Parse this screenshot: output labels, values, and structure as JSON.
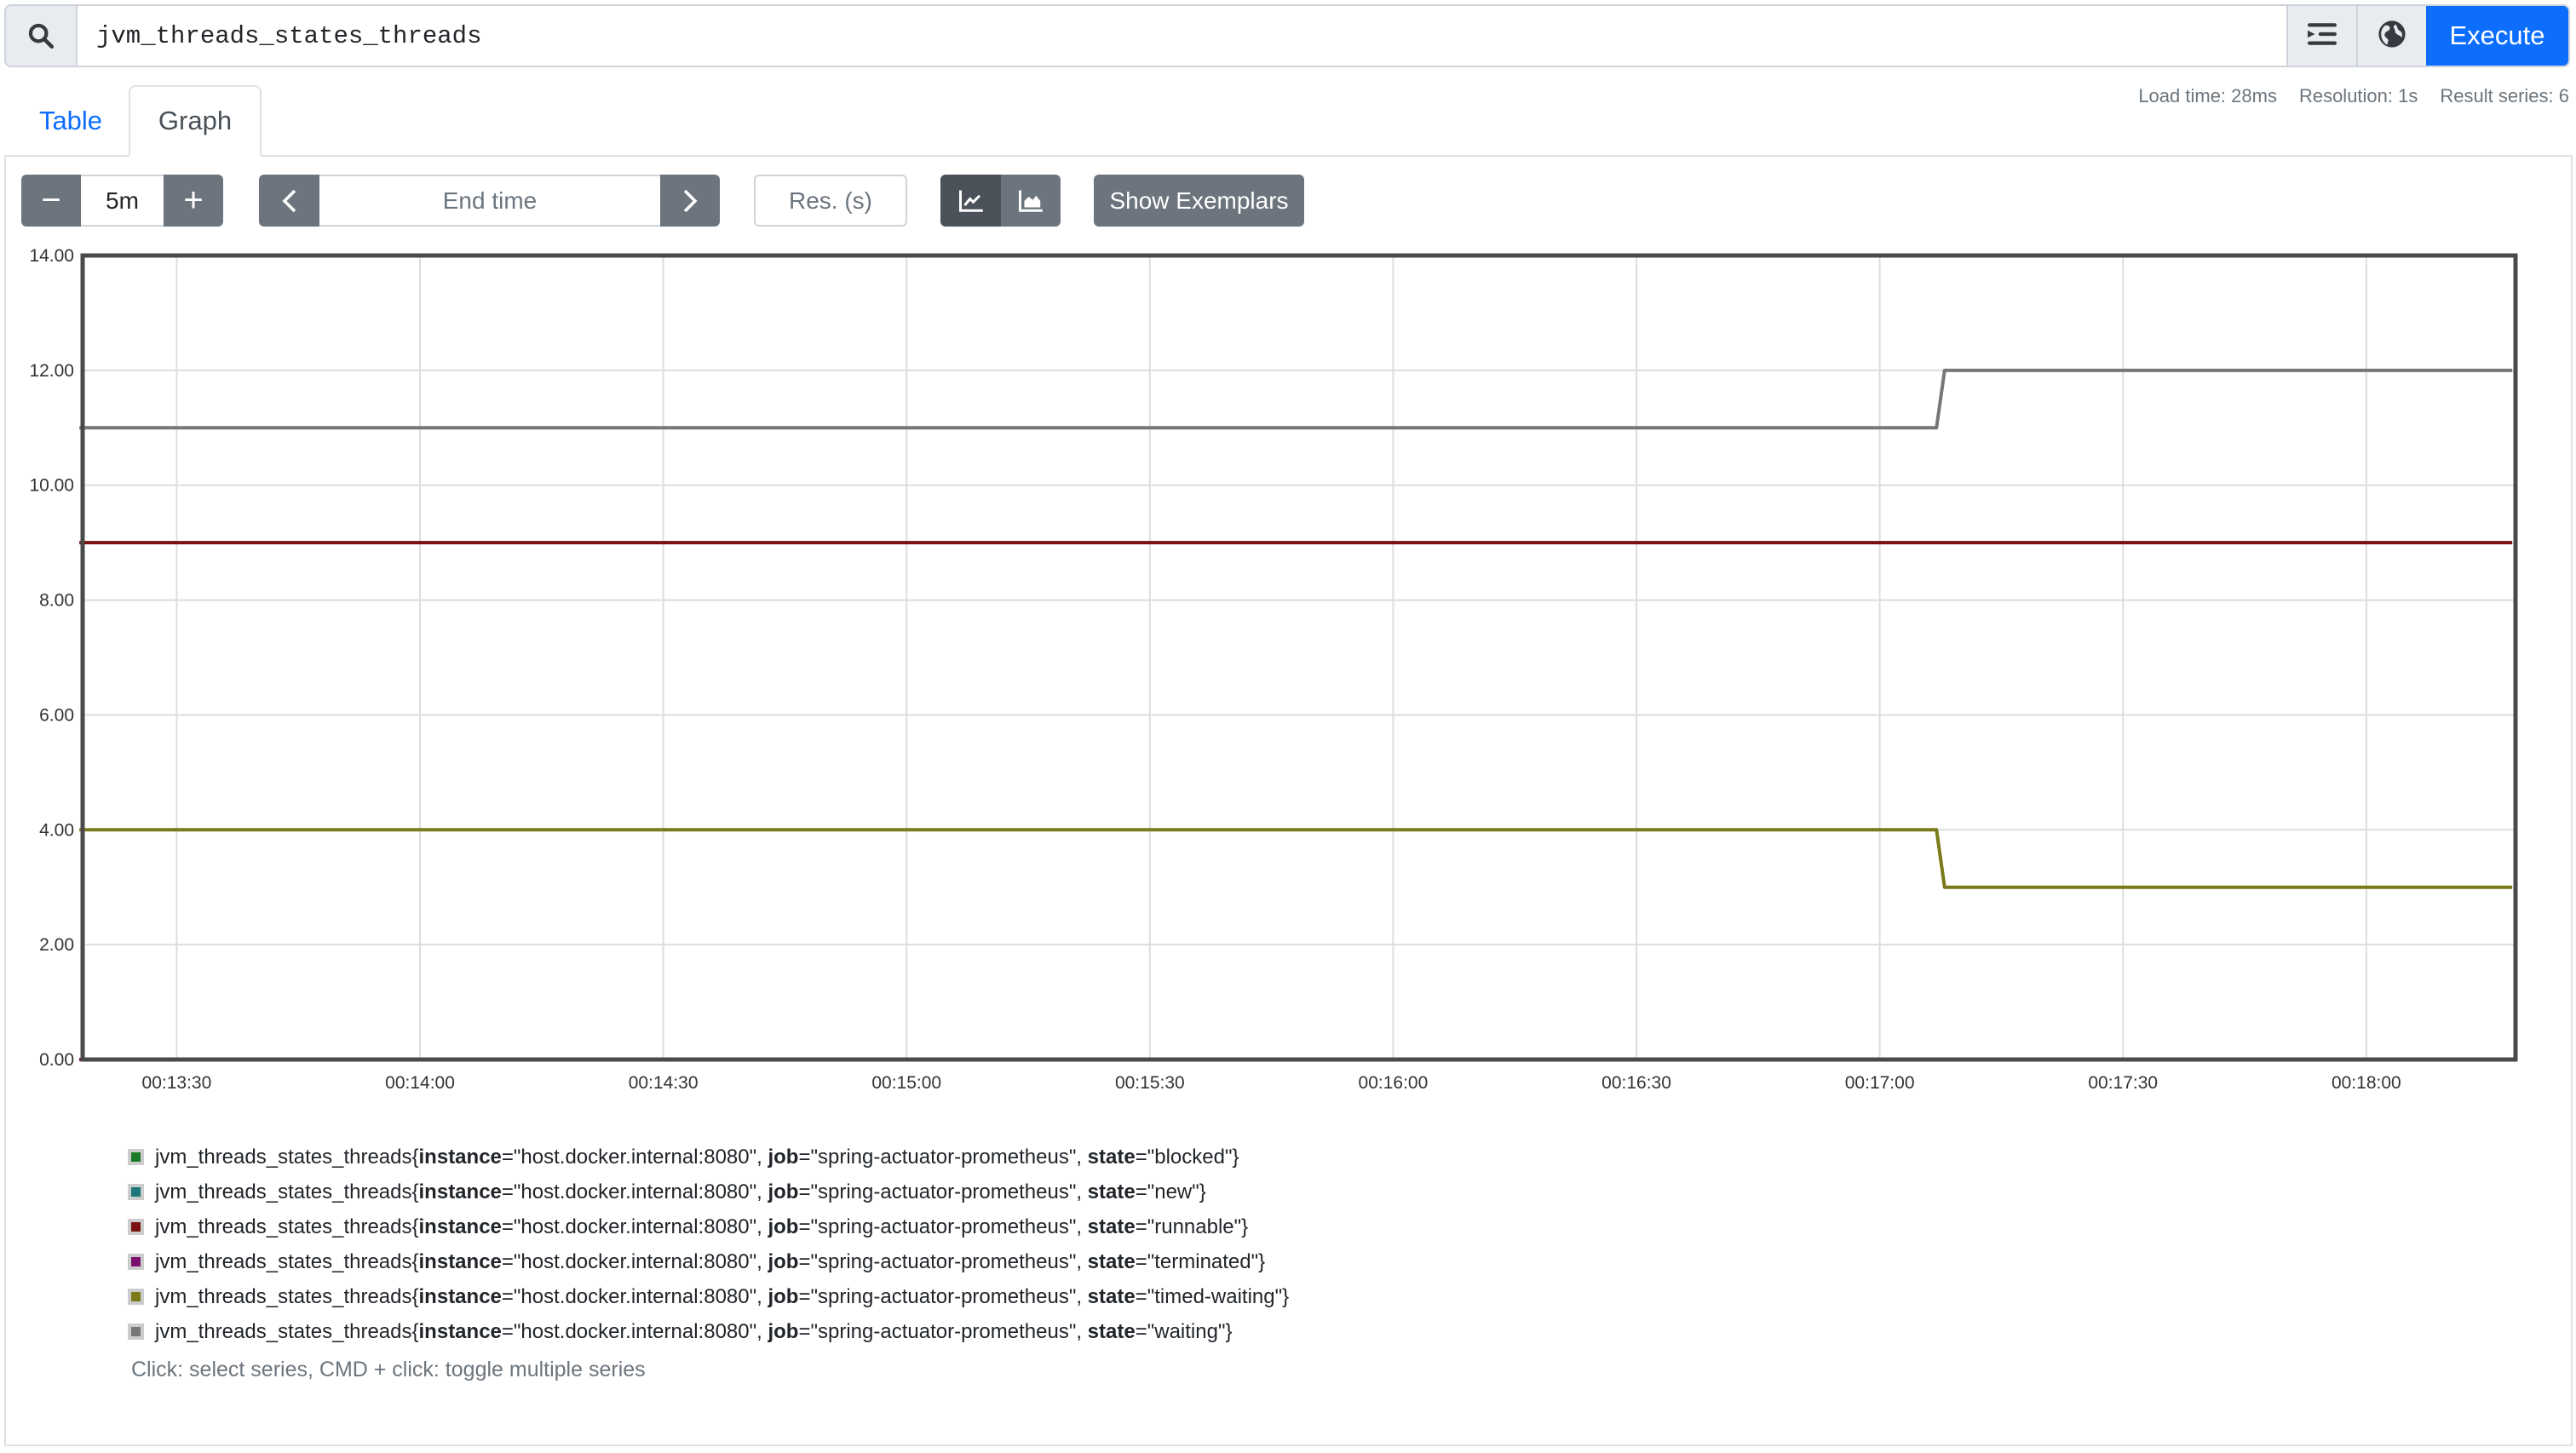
{
  "query": {
    "value": "jvm_threads_states_threads",
    "icons": {
      "search": "search-icon",
      "format": "format-indent-icon",
      "explorer": "globe-icon"
    },
    "execute_label": "Execute"
  },
  "tabs": [
    {
      "label": "Table",
      "active": false
    },
    {
      "label": "Graph",
      "active": true
    }
  ],
  "stats": {
    "load_time": "Load time: 28ms",
    "resolution": "Resolution: 1s",
    "result_series": "Result series: 6"
  },
  "controls": {
    "range_minus": "−",
    "range_value": "5m",
    "range_plus": "+",
    "prev": "‹",
    "end_time_placeholder": "End time",
    "next": "›",
    "res_placeholder": "Res. (s)",
    "line_mode_active": true,
    "show_exemplars_label": "Show Exemplars"
  },
  "legend_hint": "Click: select series, CMD + click: toggle multiple series",
  "metric_name": "jvm_threads_states_threads",
  "chart_data": {
    "type": "line",
    "title": "",
    "xlabel": "",
    "ylabel": "",
    "x_range": [
      "00:13:18",
      "00:18:18"
    ],
    "ylim": [
      0,
      14
    ],
    "y_ticks": [
      "0.00",
      "2.00",
      "4.00",
      "6.00",
      "8.00",
      "10.00",
      "12.00",
      "14.00"
    ],
    "x_ticks": [
      "00:13:30",
      "00:14:00",
      "00:14:30",
      "00:15:00",
      "00:15:30",
      "00:16:00",
      "00:16:30",
      "00:17:00",
      "00:17:30",
      "00:18:00"
    ],
    "grid": true,
    "legend_position": "bottom",
    "series": [
      {
        "name": "jvm_threads_states_threads{instance=\"host.docker.internal:8080\", job=\"spring-actuator-prometheus\", state=\"blocked\"}",
        "labels": {
          "instance": "host.docker.internal:8080",
          "job": "spring-actuator-prometheus",
          "state": "blocked"
        },
        "color": "#1b7a27",
        "points": [
          [
            "00:13:18",
            0
          ],
          [
            "00:18:18",
            0
          ]
        ]
      },
      {
        "name": "jvm_threads_states_threads{instance=\"host.docker.internal:8080\", job=\"spring-actuator-prometheus\", state=\"new\"}",
        "labels": {
          "instance": "host.docker.internal:8080",
          "job": "spring-actuator-prometheus",
          "state": "new"
        },
        "color": "#1a7878",
        "points": [
          [
            "00:13:18",
            0
          ],
          [
            "00:18:18",
            0
          ]
        ]
      },
      {
        "name": "jvm_threads_states_threads{instance=\"host.docker.internal:8080\", job=\"spring-actuator-prometheus\", state=\"runnable\"}",
        "labels": {
          "instance": "host.docker.internal:8080",
          "job": "spring-actuator-prometheus",
          "state": "runnable"
        },
        "color": "#7a1010",
        "points": [
          [
            "00:13:18",
            9
          ],
          [
            "00:18:18",
            9
          ]
        ]
      },
      {
        "name": "jvm_threads_states_threads{instance=\"host.docker.internal:8080\", job=\"spring-actuator-prometheus\", state=\"terminated\"}",
        "labels": {
          "instance": "host.docker.internal:8080",
          "job": "spring-actuator-prometheus",
          "state": "terminated"
        },
        "color": "#7a0f6e",
        "points": [
          [
            "00:13:18",
            0
          ],
          [
            "00:18:18",
            0
          ]
        ]
      },
      {
        "name": "jvm_threads_states_threads{instance=\"host.docker.internal:8080\", job=\"spring-actuator-prometheus\", state=\"timed-waiting\"}",
        "labels": {
          "instance": "host.docker.internal:8080",
          "job": "spring-actuator-prometheus",
          "state": "timed-waiting"
        },
        "color": "#7a7a1a",
        "points": [
          [
            "00:13:18",
            4
          ],
          [
            "00:17:07",
            4
          ],
          [
            "00:17:08",
            3
          ],
          [
            "00:18:18",
            3
          ]
        ]
      },
      {
        "name": "jvm_threads_states_threads{instance=\"host.docker.internal:8080\", job=\"spring-actuator-prometheus\", state=\"waiting\"}",
        "labels": {
          "instance": "host.docker.internal:8080",
          "job": "spring-actuator-prometheus",
          "state": "waiting"
        },
        "color": "#777777",
        "points": [
          [
            "00:13:18",
            11
          ],
          [
            "00:17:07",
            11
          ],
          [
            "00:17:08",
            12
          ],
          [
            "00:18:18",
            12
          ]
        ]
      }
    ]
  }
}
